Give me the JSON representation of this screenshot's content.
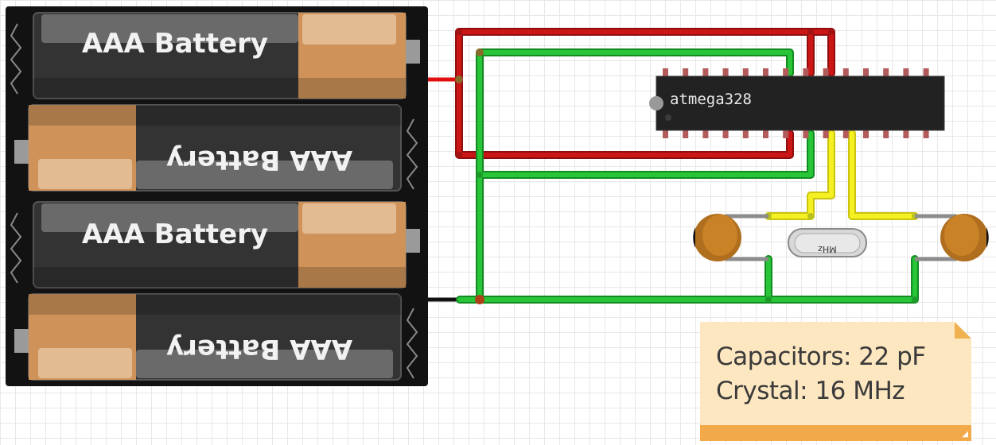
{
  "batteries": {
    "label": "AAA Battery",
    "count": 4
  },
  "chip": {
    "label": "atmega328",
    "pins_per_side": 14
  },
  "crystal": {
    "label": "MHz"
  },
  "note": {
    "line1": "Capacitors: 22 pF",
    "line2": "Crystal: 16 MHz"
  },
  "wires": {
    "power_color": "#cc1111",
    "ground_color": "#22bb33",
    "signal_color": "#f0ee20"
  }
}
